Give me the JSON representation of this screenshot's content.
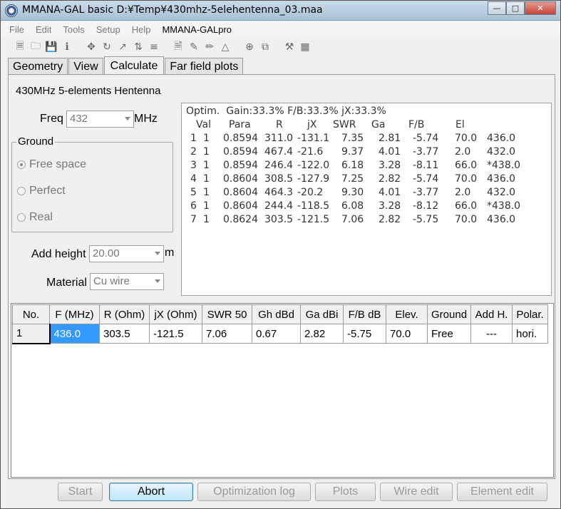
{
  "window": {
    "title": "MMANA-GAL basic D:¥Temp¥430mhz-5elehentenna_03.maa",
    "min_icon": "minimize-icon",
    "max_icon": "maximize-icon",
    "close_icon": "close-icon"
  },
  "menu": [
    "File",
    "Edit",
    "Tools",
    "Setup",
    "Help",
    "MMANA-GALpro"
  ],
  "tabs": [
    "Geometry",
    "View",
    "Calculate",
    "Far field plots"
  ],
  "selected_tab": "Calculate",
  "form": {
    "project_title": "430MHz 5-elements Hentenna",
    "freq_label": "Freq",
    "freq_value": "432",
    "freq_unit": "MHz",
    "ground_title": "Ground",
    "ground_options": [
      "Free space",
      "Perfect",
      "Real"
    ],
    "ground_selected": "Free space",
    "add_height_label": "Add height",
    "add_height_value": "20.00",
    "add_height_unit": "m",
    "material_label": "Material",
    "material_value": "Cu wire"
  },
  "optim": {
    "header": "Optim.  Gain:33.3% F/B:33.3% jX:33.3%",
    "columns": [
      "Val",
      "Para",
      "R",
      "jX",
      "SWR",
      "Ga",
      "F/B",
      "El"
    ],
    "rows": [
      [
        "1",
        "1",
        "0.8594",
        "311.0",
        "-131.1",
        "7.35",
        "2.81",
        "-5.74",
        "70.0",
        "436.0"
      ],
      [
        "2",
        "1",
        "0.8594",
        "467.4",
        "-21.6",
        "9.37",
        "4.01",
        "-3.77",
        "2.0",
        "432.0"
      ],
      [
        "3",
        "1",
        "0.8594",
        "246.4",
        "-122.0",
        "6.18",
        "3.28",
        "-8.11",
        "66.0",
        "*438.0"
      ],
      [
        "4",
        "1",
        "0.8604",
        "308.5",
        "-127.9",
        "7.25",
        "2.82",
        "-5.74",
        "70.0",
        "436.0"
      ],
      [
        "5",
        "1",
        "0.8604",
        "464.3",
        "-20.2",
        "9.30",
        "4.01",
        "-3.77",
        "2.0",
        "432.0"
      ],
      [
        "6",
        "1",
        "0.8604",
        "244.4",
        "-118.5",
        "6.08",
        "3.28",
        "-8.12",
        "66.0",
        "*438.0"
      ],
      [
        "7",
        "1",
        "0.8624",
        "303.5",
        "-121.5",
        "7.06",
        "2.82",
        "-5.75",
        "70.0",
        "436.0"
      ]
    ]
  },
  "results_table": {
    "headers": [
      "No.",
      "F (MHz)",
      "R (Ohm)",
      "jX (Ohm)",
      "SWR 50",
      "Gh dBd",
      "Ga dBi",
      "F/B dB",
      "Elev.",
      "Ground",
      "Add H.",
      "Polar."
    ],
    "rows": [
      [
        "1",
        "436.0",
        "303.5",
        "-121.5",
        "7.06",
        "0.67",
        "2.82",
        "-5.75",
        "70.0",
        "Free",
        "---",
        "hori."
      ]
    ]
  },
  "buttons": {
    "start": "Start",
    "abort": "Abort",
    "optimization_log": "Optimization log",
    "plots": "Plots",
    "wire_edit": "Wire edit",
    "element_edit": "Element edit"
  },
  "colors": {
    "selection": "#3399ff",
    "titlebar": "#b9cfe1"
  }
}
